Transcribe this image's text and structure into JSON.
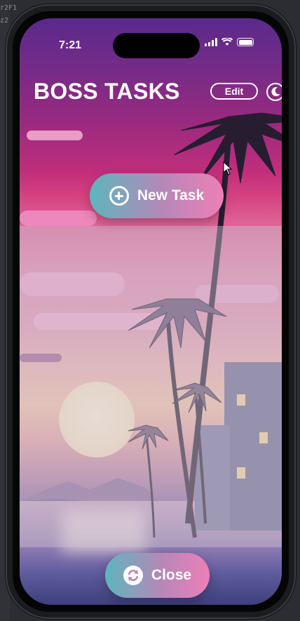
{
  "editor": {
    "line1": "r2F1",
    "line2": "z2"
  },
  "status_bar": {
    "time": "7:21"
  },
  "header": {
    "title": "BOSS TASKS",
    "edit_label": "Edit"
  },
  "actions": {
    "new_task_label": "New Task",
    "close_label": "Close"
  },
  "icons": {
    "new_task": "plus-circle-icon",
    "close": "refresh-icon",
    "theme": "moon-icon",
    "signal": "cellular-signal-icon",
    "wifi": "wifi-icon",
    "battery": "battery-icon"
  },
  "colors": {
    "button_gradient_start": "#5cb6bd",
    "button_gradient_end": "#ee7fb7",
    "text": "#ffffff"
  }
}
